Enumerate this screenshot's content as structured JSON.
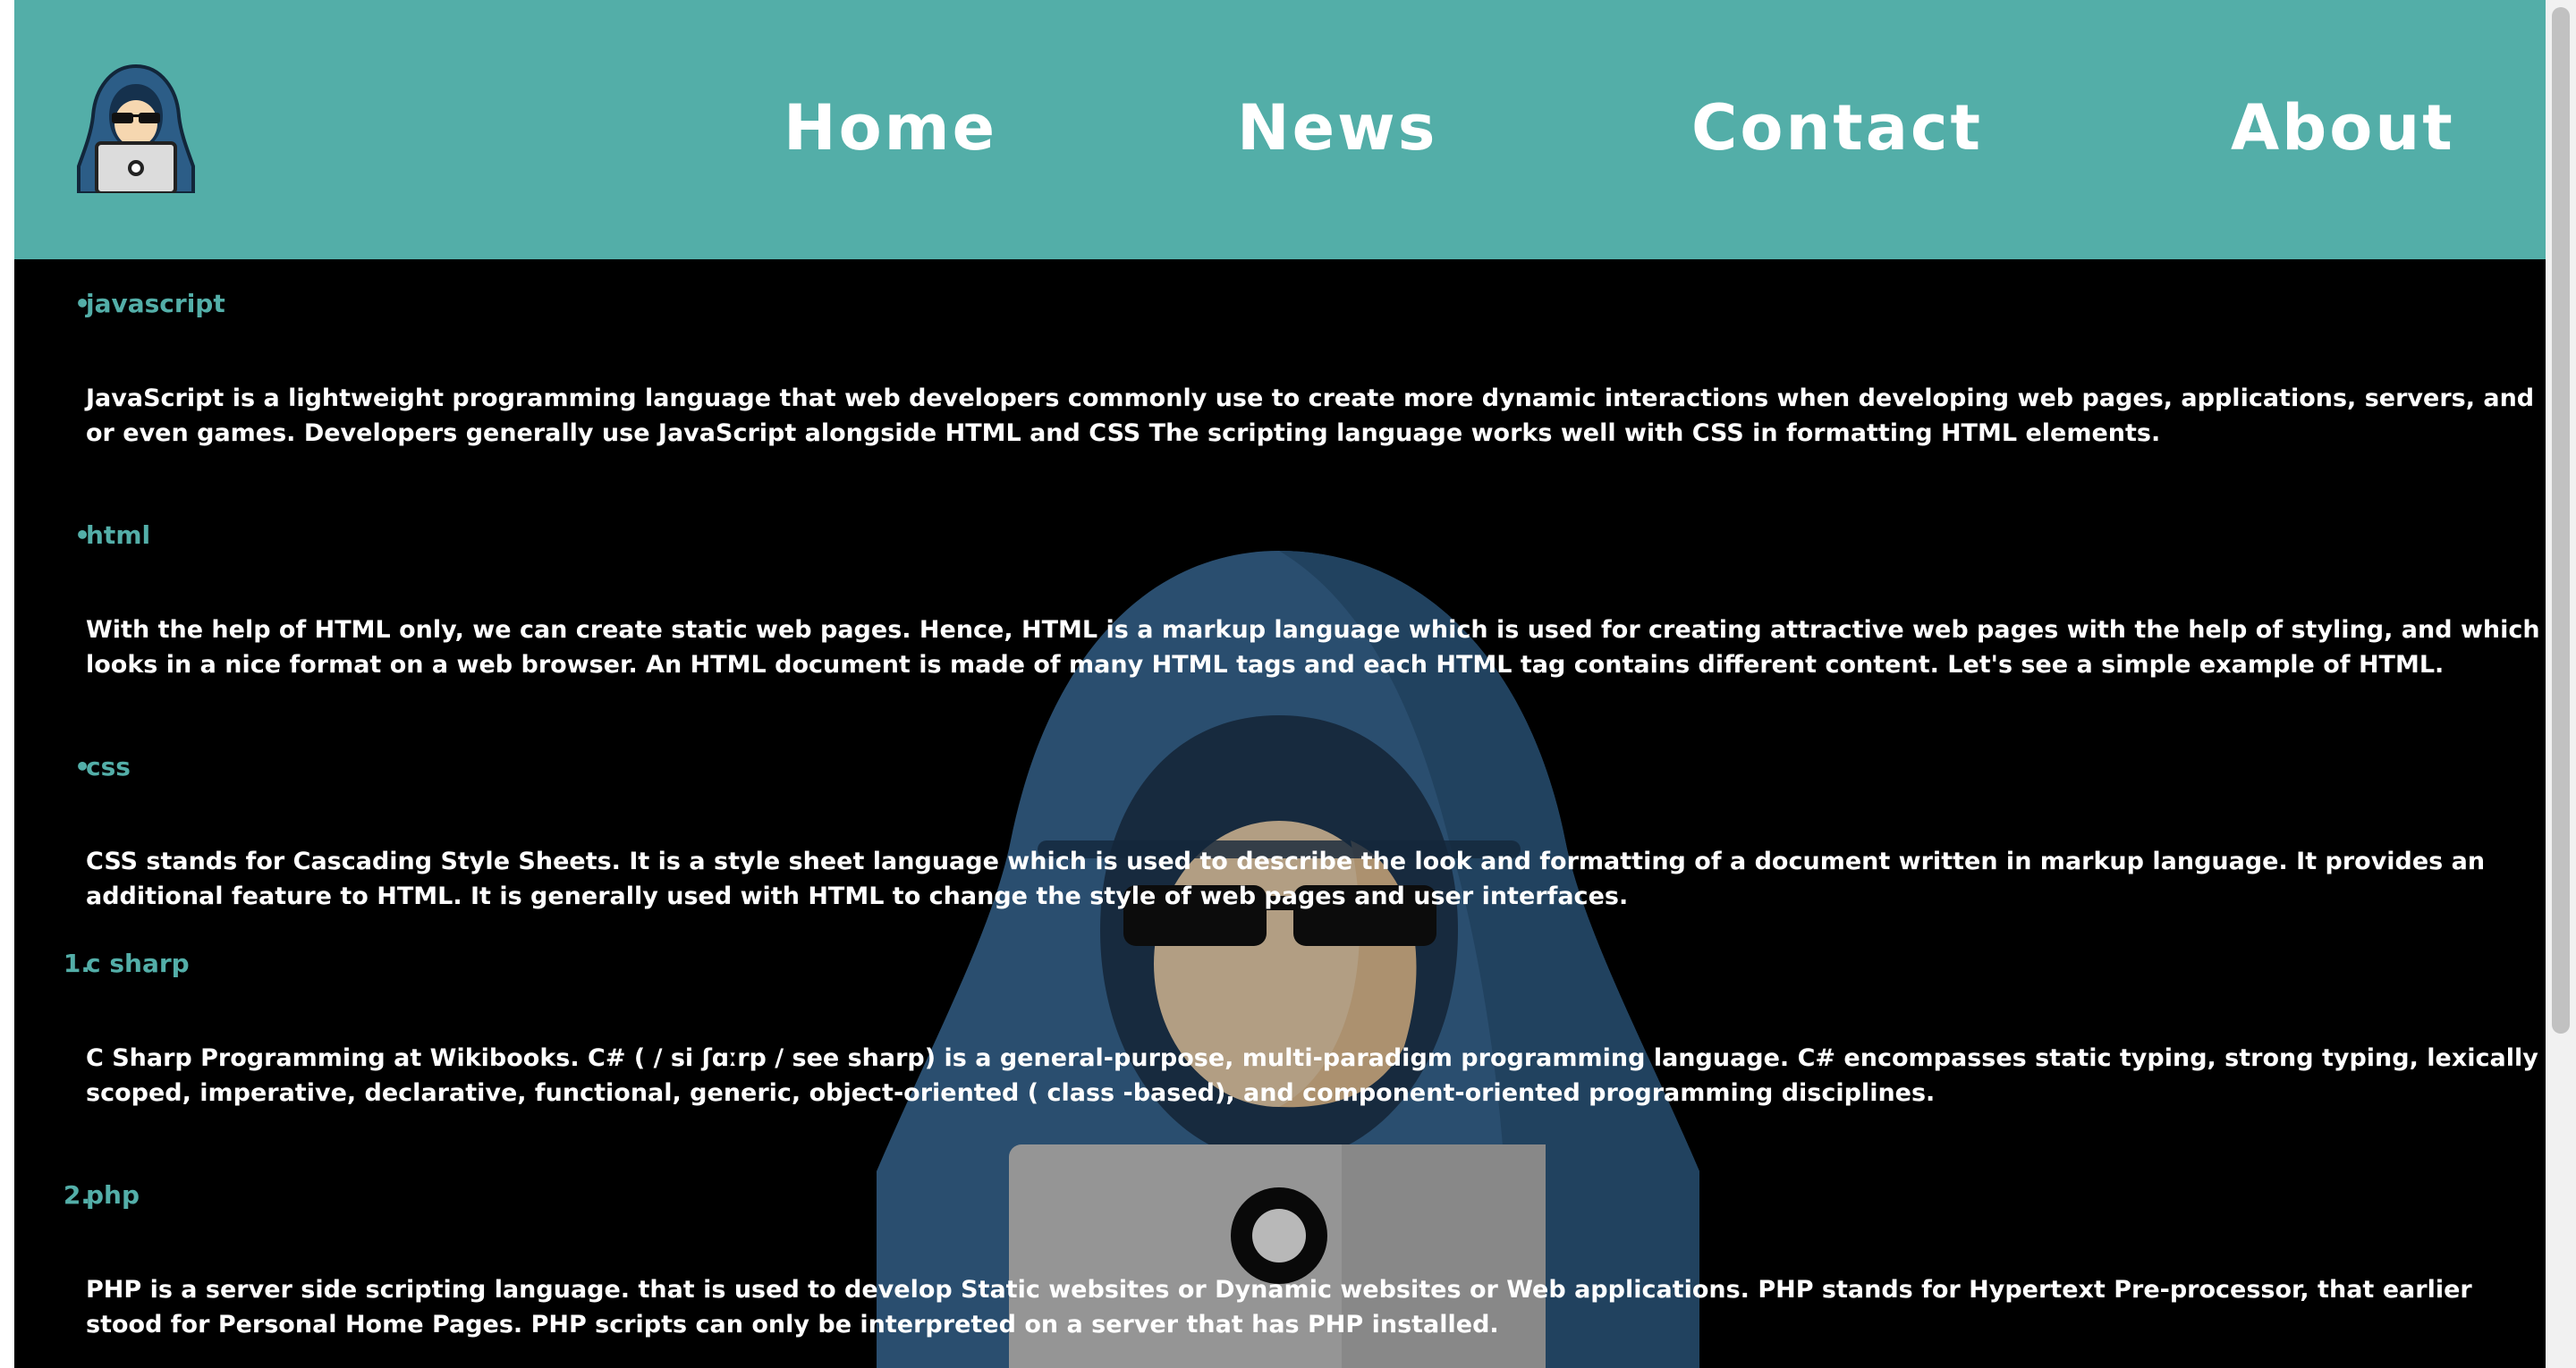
{
  "nav": {
    "logo": "hacker-logo-icon",
    "items": [
      "Home",
      "News",
      "Contact",
      "About"
    ]
  },
  "background_image": "hooded-hacker-with-laptop",
  "colors": {
    "header": "#53aea8",
    "page_background": "#000000",
    "text": "#ffffff",
    "accent": "#53aea8"
  },
  "sections": [
    {
      "marker": "•",
      "title": "javascript",
      "text": "JavaScript is a lightweight programming language that web developers commonly use to create more dynamic interactions when developing web pages, applications, servers, and or even games. Developers generally use JavaScript alongside HTML and CSS The scripting language works well with CSS in formatting HTML elements."
    },
    {
      "marker": "•",
      "title": "html",
      "text": "With the help of HTML only, we can create static web pages. Hence, HTML is a markup language which is used for creating attractive web pages with the help of styling, and which looks in a nice format on a web browser. An HTML document is made of many HTML tags and each HTML tag contains different content. Let's see a simple example of HTML."
    },
    {
      "marker": "•",
      "title": "css",
      "text": "CSS stands for Cascading Style Sheets. It is a style sheet language which is used to describe the look and formatting of a document written in markup language. It provides an additional feature to HTML. It is generally used with HTML to change the style of web pages and user interfaces."
    },
    {
      "marker": "1.",
      "title": "c sharp",
      "text": "C Sharp Programming at Wikibooks. C# ( / si ʃɑːrp / see sharp) is a general-purpose, multi-paradigm programming language. C# encompasses static typing, strong typing, lexically scoped, imperative, declarative, functional, generic, object-oriented ( class -based), and component-oriented programming disciplines."
    },
    {
      "marker": "2.",
      "title": "php",
      "text": "PHP is a server side scripting language. that is used to develop Static websites or Dynamic websites or Web applications. PHP stands for Hypertext Pre-processor, that earlier stood for Personal Home Pages. PHP scripts can only be interpreted on a server that has PHP installed."
    }
  ]
}
